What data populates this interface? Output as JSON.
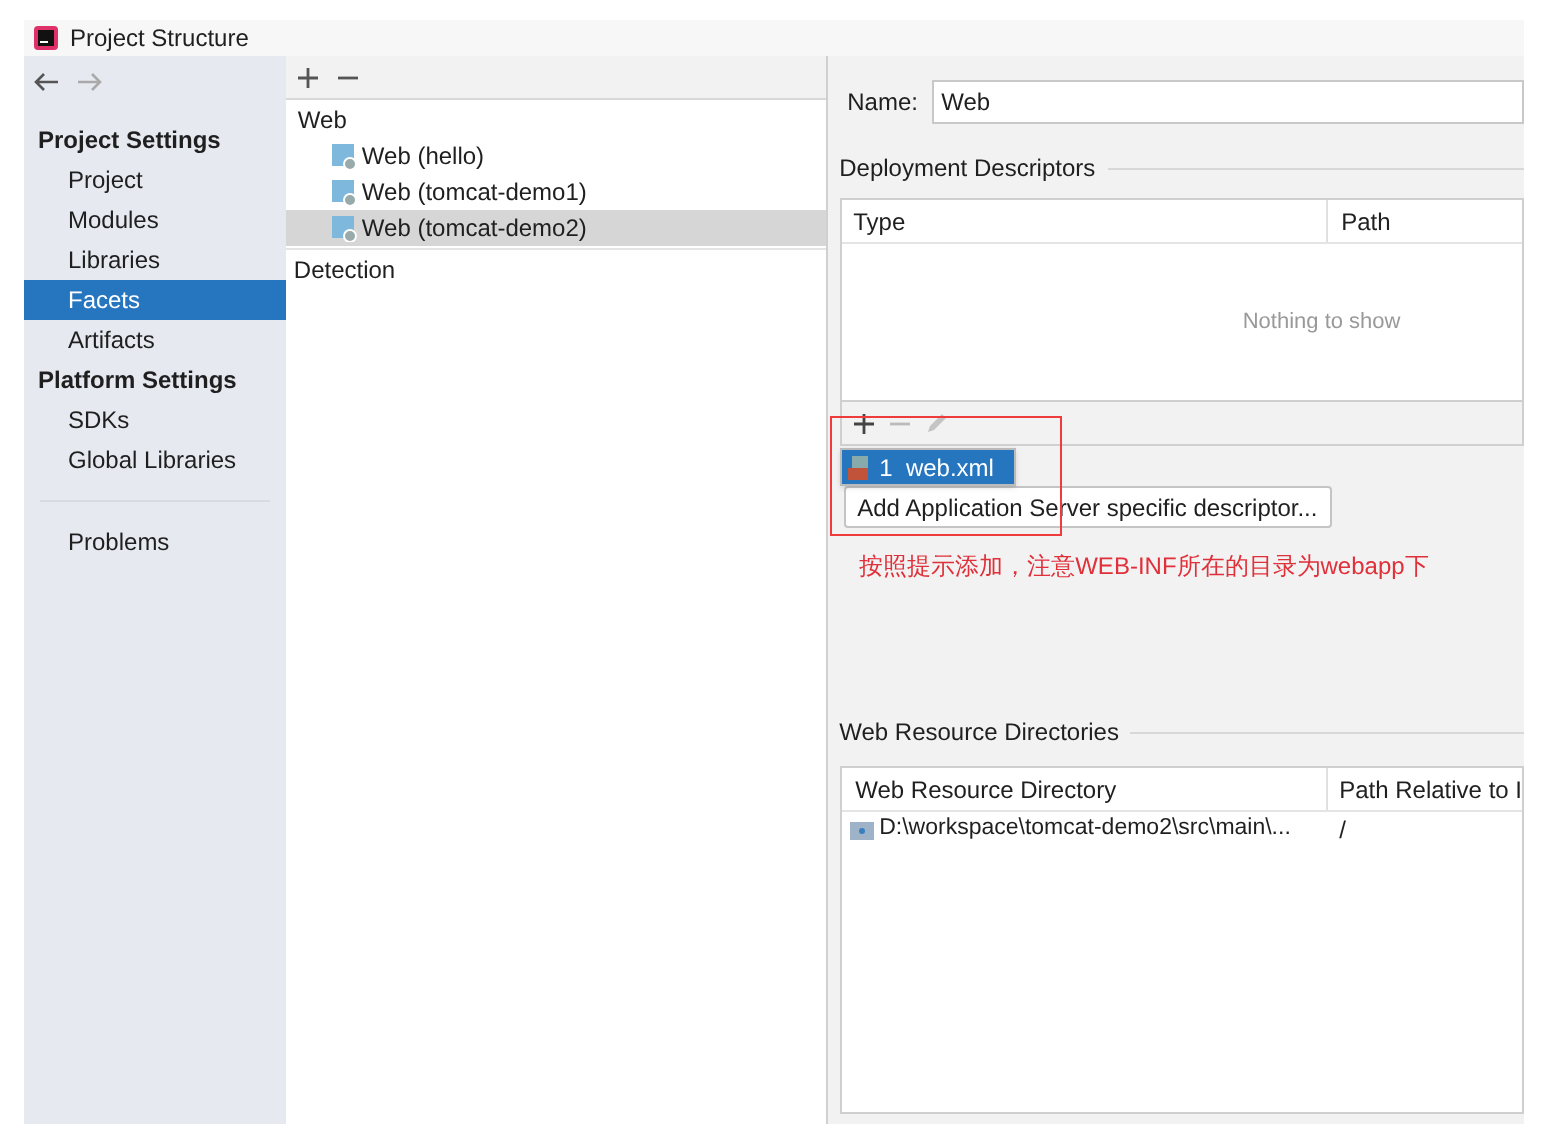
{
  "window": {
    "title": "Project Structure"
  },
  "sidebar": {
    "groups": [
      {
        "heading": "Project Settings",
        "items": [
          {
            "label": "Project",
            "selected": false
          },
          {
            "label": "Modules",
            "selected": false
          },
          {
            "label": "Libraries",
            "selected": false
          },
          {
            "label": "Facets",
            "selected": true
          },
          {
            "label": "Artifacts",
            "selected": false
          }
        ]
      },
      {
        "heading": "Platform Settings",
        "items": [
          {
            "label": "SDKs",
            "selected": false
          },
          {
            "label": "Global Libraries",
            "selected": false
          }
        ]
      }
    ],
    "bottom_items": [
      {
        "label": "Problems",
        "selected": false
      }
    ]
  },
  "facets": {
    "group": "Web",
    "items": [
      {
        "label": "Web (hello)",
        "selected": false
      },
      {
        "label": "Web (tomcat-demo1)",
        "selected": false
      },
      {
        "label": "Web (tomcat-demo2)",
        "selected": true
      }
    ],
    "detection": "Detection"
  },
  "details": {
    "name_label": "Name:",
    "name_value": "Web",
    "deployment": {
      "title": "Deployment Descriptors",
      "columns": [
        "Type",
        "Path"
      ],
      "empty": "Nothing to show",
      "popup_items": [
        {
          "label": "1  web.xml",
          "selected": true
        }
      ],
      "button": "Add Application Server specific descriptor..."
    },
    "annotation": "按照提示添加，注意WEB-INF所在的目录为webapp下",
    "resources": {
      "title": "Web Resource Directories",
      "columns": [
        "Web Resource Directory",
        "Path Relative to I"
      ],
      "rows": [
        [
          "D:\\workspace\\tomcat-demo2\\src\\main\\...",
          "/"
        ]
      ]
    }
  }
}
